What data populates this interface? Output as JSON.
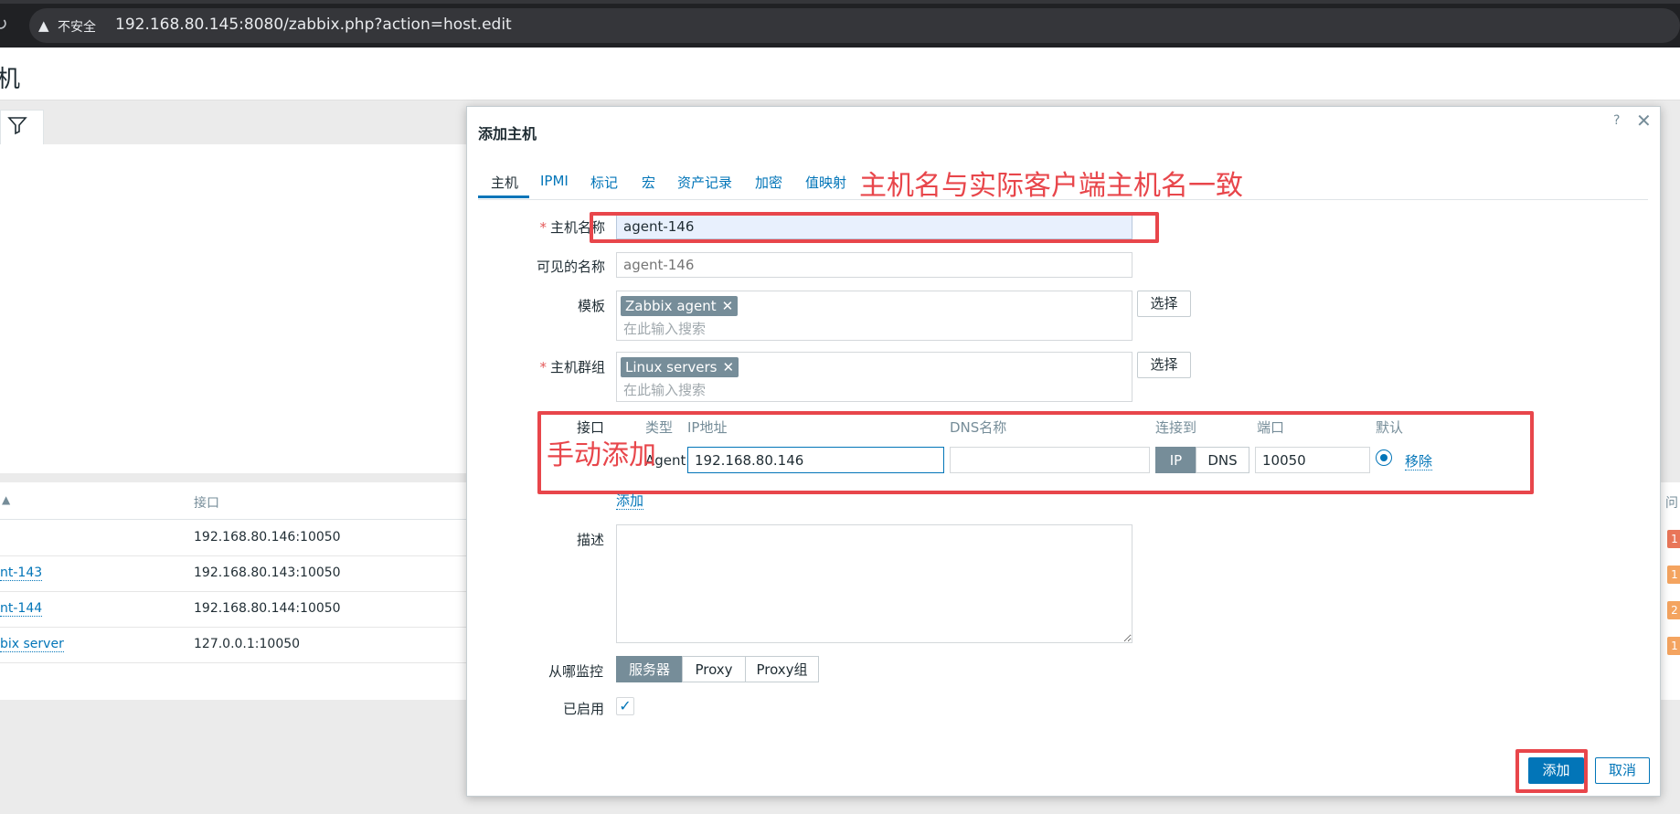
{
  "browser": {
    "security_label": "不安全",
    "url": "192.168.80.145:8080/zabbix.php?action=host.edit"
  },
  "background": {
    "page_title_partial": "机",
    "table": {
      "sort_indicator": "▲",
      "header_interface": "接口",
      "right_header_partial": "问",
      "rows": [
        {
          "name": "",
          "interface": "192.168.80.146:10050"
        },
        {
          "name": "nt-143",
          "interface": "192.168.80.143:10050"
        },
        {
          "name": "nt-144",
          "interface": "192.168.80.144:10050"
        },
        {
          "name": "bix server",
          "interface": "127.0.0.1:10050"
        }
      ],
      "right_badges": [
        "1",
        "1",
        "2",
        "1"
      ],
      "badge_colors": [
        "#e97659",
        "#f4a460",
        "#f4a460",
        "#f4a460"
      ]
    }
  },
  "modal": {
    "title": "添加主机",
    "help": "?",
    "close": "✕",
    "tabs": [
      "主机",
      "IPMI",
      "标记",
      "宏",
      "资产记录",
      "加密",
      "值映射"
    ],
    "active_tab": "主机",
    "annotations": {
      "hostname_note": "主机名与实际客户端主机名一致",
      "interface_note": "手动添加"
    },
    "form": {
      "host_name_label": "主机名称",
      "host_name_value": "agent-146",
      "visible_name_label": "可见的名称",
      "visible_name_placeholder": "agent-146",
      "templates_label": "模板",
      "templates_chip": "Zabbix agent",
      "search_placeholder": "在此输入搜索",
      "select_button": "选择",
      "host_groups_label": "主机群组",
      "host_groups_chip": "Linux servers",
      "interfaces_label": "接口",
      "interface_headers": {
        "type": "类型",
        "ip": "IP地址",
        "dns": "DNS名称",
        "connect_to": "连接到",
        "port": "端口",
        "default": "默认"
      },
      "interface_row": {
        "type": "Agent",
        "ip": "192.168.80.146",
        "dns": "",
        "connect_options": [
          "IP",
          "DNS"
        ],
        "connect_selected": "IP",
        "port": "10050",
        "remove": "移除"
      },
      "add_interface_link": "添加",
      "description_label": "描述",
      "description_value": "",
      "monitored_by_label": "从哪监控",
      "monitored_by_options": [
        "服务器",
        "Proxy",
        "Proxy组"
      ],
      "monitored_by_selected": "服务器",
      "enabled_label": "已启用",
      "enabled_checked": true
    },
    "buttons": {
      "add": "添加",
      "cancel": "取消"
    }
  }
}
